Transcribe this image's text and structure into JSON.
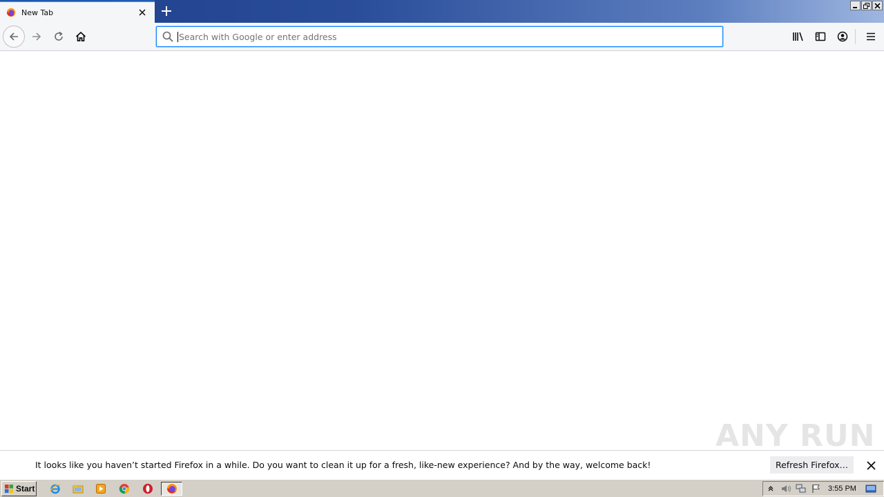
{
  "browser": {
    "tabs": [
      {
        "title": "New Tab",
        "favicon": "firefox-icon",
        "active": true
      }
    ],
    "new_tab_icon": "plus-icon",
    "window_controls": [
      "minimize-icon",
      "restore-icon",
      "close-icon"
    ]
  },
  "toolbar": {
    "back_icon": "arrow-left-icon",
    "forward_icon": "arrow-right-icon",
    "reload_icon": "reload-icon",
    "home_icon": "home-icon",
    "urlbar": {
      "value": "",
      "placeholder": "Search with Google or enter address",
      "icon": "search-icon"
    },
    "right_icons": [
      "library-icon",
      "sidebar-icon",
      "account-icon",
      "menu-icon"
    ]
  },
  "notification": {
    "message": "It looks like you haven’t started Firefox in a while. Do you want to clean it up for a fresh, like-new experience? And by the way, welcome back!",
    "button_label": "Refresh Firefox…",
    "close_icon": "close-icon"
  },
  "watermark": {
    "text": "ANY RUN"
  },
  "taskbar": {
    "start_label": "Start",
    "apps": [
      "internet-explorer-icon",
      "file-explorer-icon",
      "media-player-icon",
      "chrome-icon",
      "opera-icon",
      "firefox-icon"
    ],
    "active_app": "firefox-icon",
    "tray_icons": [
      "chevron-up-icon",
      "volume-icon",
      "network-icon",
      "flag-icon"
    ],
    "clock": "3:55 PM"
  },
  "colors": {
    "accent": "#0a84ff",
    "tabbar_gradient_start": "#1f3f8a",
    "toolbar_bg": "#f5f6f7",
    "taskbar_bg": "#d4d0c8"
  }
}
